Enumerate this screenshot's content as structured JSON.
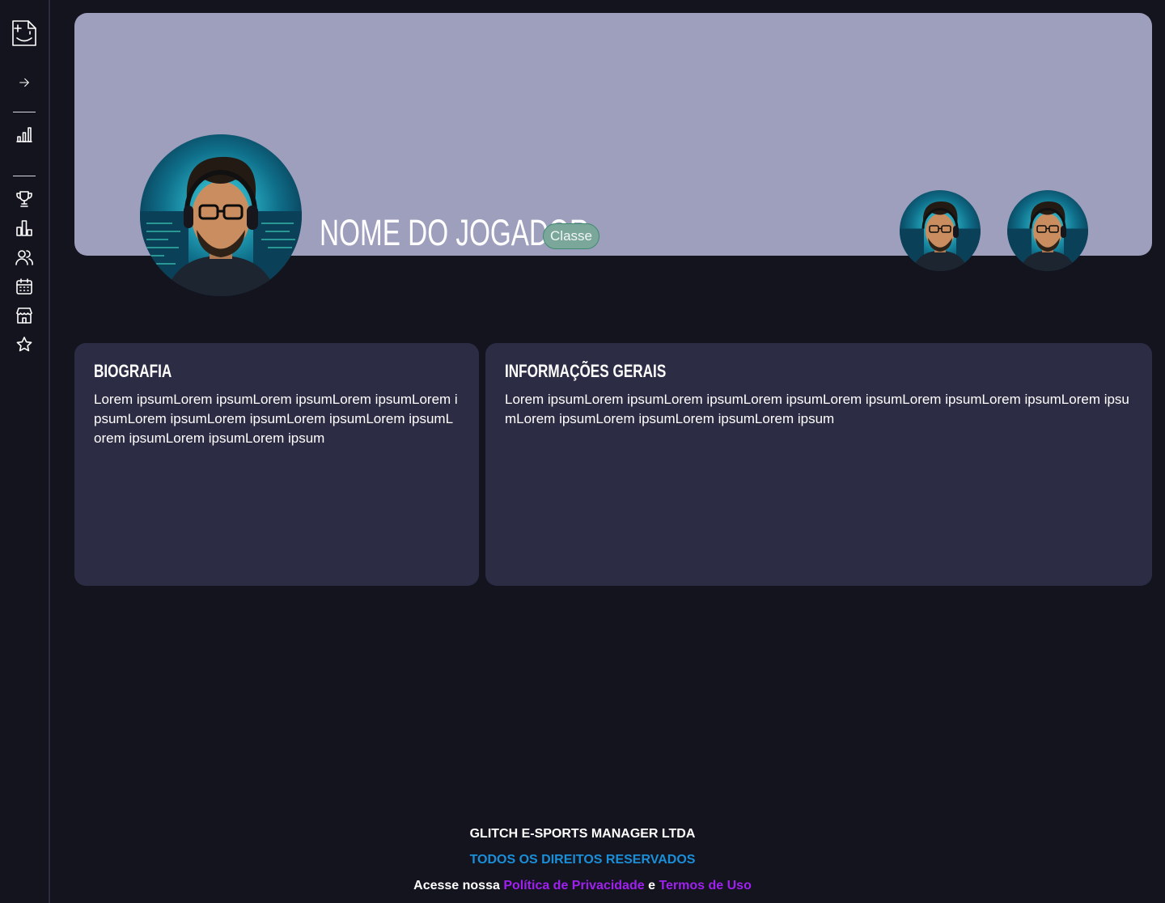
{
  "sidebar": {
    "logo_icon": "smile-document-icon",
    "expand_icon": "arrow-right-icon",
    "items": [
      {
        "icon": "signal-bars-icon",
        "name": "sidebar-item-stats"
      },
      {
        "icon": "trophy-icon",
        "name": "sidebar-item-trophies"
      },
      {
        "icon": "bar-chart-icon",
        "name": "sidebar-item-ranking"
      },
      {
        "icon": "users-icon",
        "name": "sidebar-item-teams"
      },
      {
        "icon": "calendar-icon",
        "name": "sidebar-item-calendar"
      },
      {
        "icon": "store-icon",
        "name": "sidebar-item-store"
      },
      {
        "icon": "star-icon",
        "name": "sidebar-item-favorites"
      }
    ]
  },
  "profile": {
    "player_name": "NOME DO JOGADOR",
    "class_label": "Classe",
    "banner_color": "#9e9ebd",
    "badge_color": "#7aa79a"
  },
  "biography": {
    "title": "BIOGRAFIA",
    "text": "Lorem ipsumLorem ipsumLorem ipsumLorem ipsumLorem ipsumLorem ipsumLorem ipsumLorem ipsumLorem ipsumLorem ipsumLorem ipsumLorem ipsum"
  },
  "general_info": {
    "title": "INFORMAÇÕES GERAIS",
    "text": "Lorem ipsumLorem ipsumLorem ipsumLorem ipsumLorem ipsumLorem ipsumLorem ipsumLorem ipsumLorem ipsumLorem ipsumLorem ipsumLorem ipsum"
  },
  "footer": {
    "company": "GLITCH E-SPORTS MANAGER LTDA",
    "rights": "TODOS OS DIREITOS RESERVADOS",
    "access_prefix": "Acesse nossa",
    "privacy_link": "Política de Privacidade",
    "conjunction": "e",
    "terms_link": "Termos de Uso",
    "rights_color": "#1a8fd8",
    "link_color": "#a020f0"
  }
}
